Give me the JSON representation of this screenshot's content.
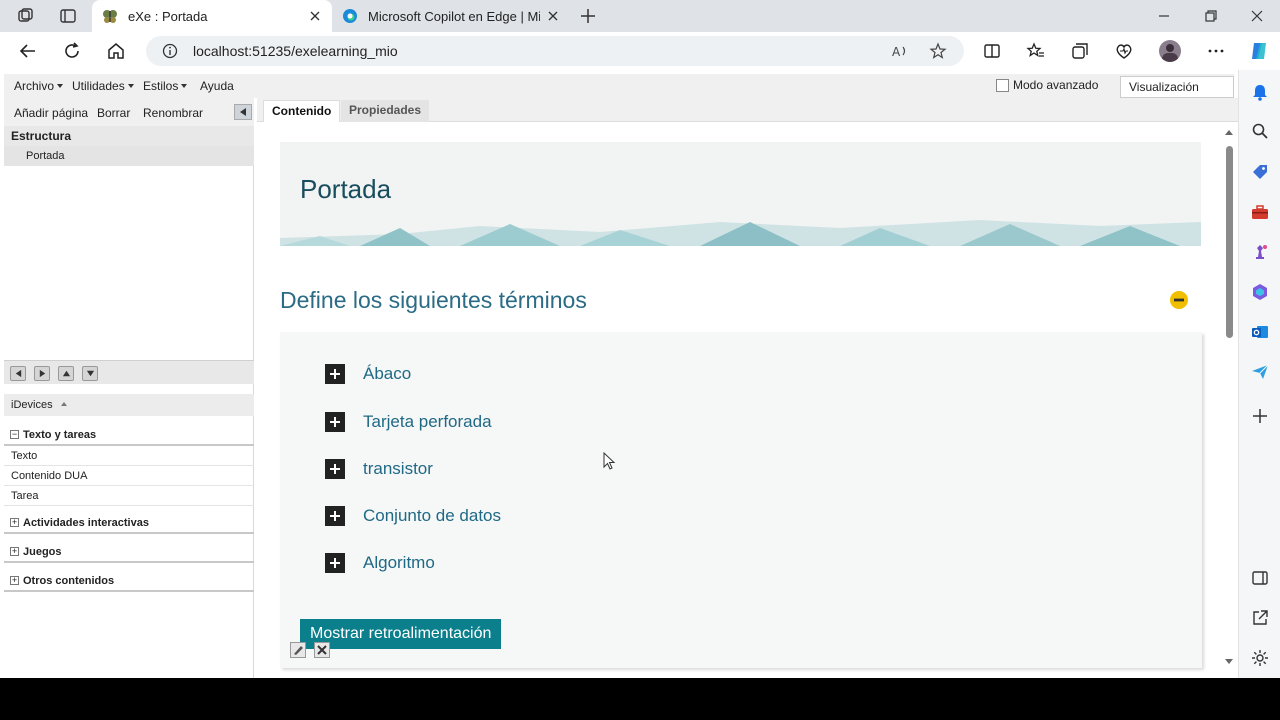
{
  "browser": {
    "tabs": [
      {
        "title": "eXe : Portada",
        "active": true
      },
      {
        "title": "Microsoft Copilot en Edge | Micr",
        "active": false
      }
    ],
    "url": "localhost:51235/exelearning_mio"
  },
  "menu": {
    "archivo": "Archivo",
    "utilidades": "Utilidades",
    "estilos": "Estilos",
    "ayuda": "Ayuda",
    "advanced_mode": "Modo avanzado",
    "preview": "Visualización previa"
  },
  "left": {
    "add_page": "Añadir página",
    "delete": "Borrar",
    "rename": "Renombrar",
    "structure": "Estructura",
    "tree": [
      "Portada"
    ],
    "idevices": "iDevices",
    "categories": {
      "text_tasks": "Texto y tareas",
      "items": [
        "Texto",
        "Contenido DUA",
        "Tarea"
      ],
      "interactive": "Actividades interactivas",
      "games": "Juegos",
      "others": "Otros contenidos"
    }
  },
  "content": {
    "tabs": {
      "content": "Contenido",
      "properties": "Propiedades"
    },
    "page_title": "Portada",
    "section_title": "Define los siguientes términos",
    "terms": [
      "Ábaco",
      "Tarjeta perforada",
      "transistor",
      "Conjunto de datos",
      "Algoritmo"
    ],
    "feedback_button": "Mostrar retroalimentación"
  },
  "colors": {
    "accent": "#0b7f8c",
    "title": "#184d5e",
    "section": "#2b6b85",
    "minus_badge": "#f0c000"
  }
}
